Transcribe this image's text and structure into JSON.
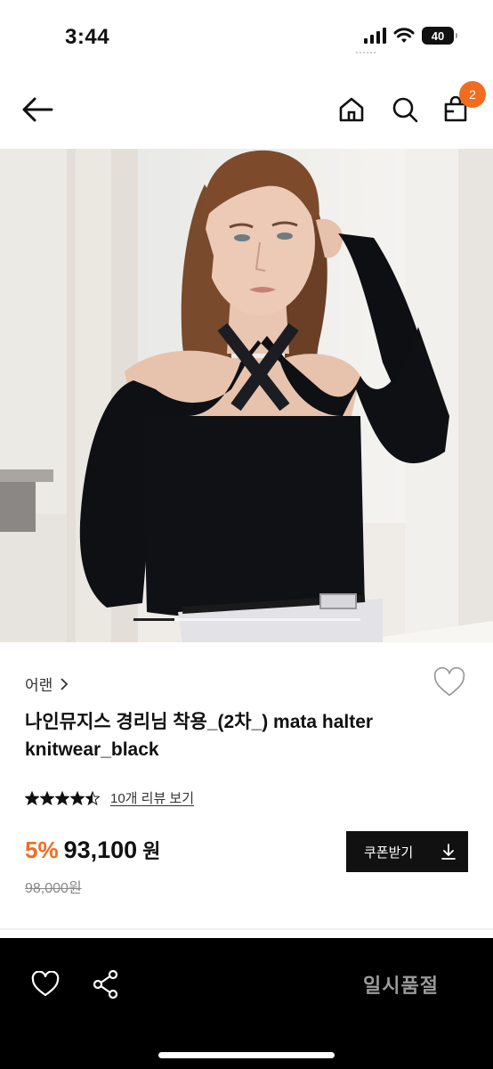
{
  "status": {
    "time": "3:44",
    "battery": "40"
  },
  "nav": {
    "cart_count": "2"
  },
  "hero": {
    "slide_index": 1,
    "slide_fraction": 0.18
  },
  "product": {
    "brand": "어랜",
    "title": "나인뮤지스 경리님 착용_(2차_) mata halter knitwear_black",
    "rating": 4.5,
    "review_link": "10개 리뷰 보기",
    "discount": "5%",
    "price": "93,100",
    "price_unit": "원",
    "original_price": "98,000원",
    "coupon_label": "쿠폰받기"
  },
  "bottom": {
    "soldout_label": "일시품절"
  },
  "colors": {
    "accent": "#f26c1f",
    "dark": "#111111",
    "muted": "#9a9a9a"
  }
}
